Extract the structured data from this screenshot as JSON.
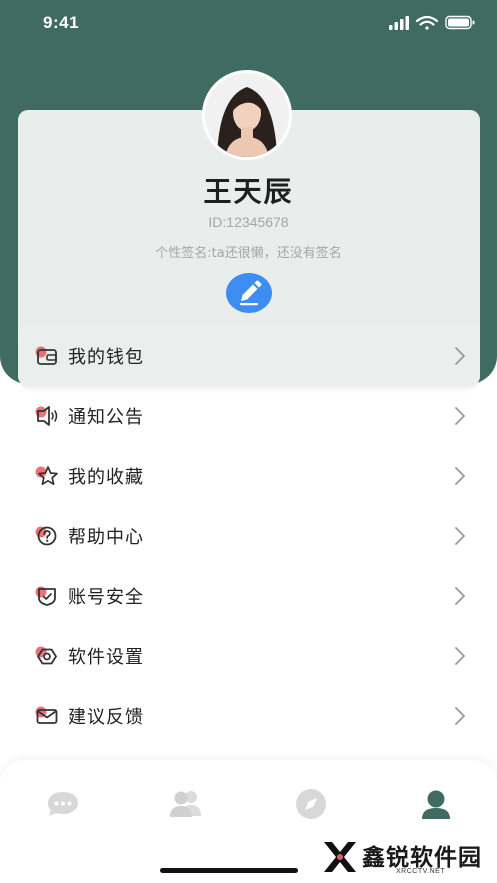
{
  "status_bar": {
    "time": "9:41"
  },
  "profile": {
    "name": "王天辰",
    "id_text": "ID:12345678",
    "signature": "个性签名:ta还很懒，还没有签名"
  },
  "menu": [
    {
      "label": "我的钱包",
      "icon": "wallet-icon"
    },
    {
      "label": "通知公告",
      "icon": "announcement-icon"
    },
    {
      "label": "我的收藏",
      "icon": "star-icon"
    },
    {
      "label": "帮助中心",
      "icon": "help-icon"
    },
    {
      "label": "账号安全",
      "icon": "shield-icon"
    },
    {
      "label": "软件设置",
      "icon": "settings-icon"
    },
    {
      "label": "建议反馈",
      "icon": "mail-icon"
    }
  ],
  "tab_bar": {
    "tabs": [
      "chat-icon",
      "contacts-icon",
      "discover-icon",
      "profile-icon"
    ],
    "active": "profile-icon"
  },
  "watermark": {
    "text": "鑫锐软件园",
    "sub": "XRCCTV.NET"
  },
  "colors": {
    "header": "#3f6b63",
    "accent": "#3d8ef0",
    "icon_red": "#e45b62"
  }
}
